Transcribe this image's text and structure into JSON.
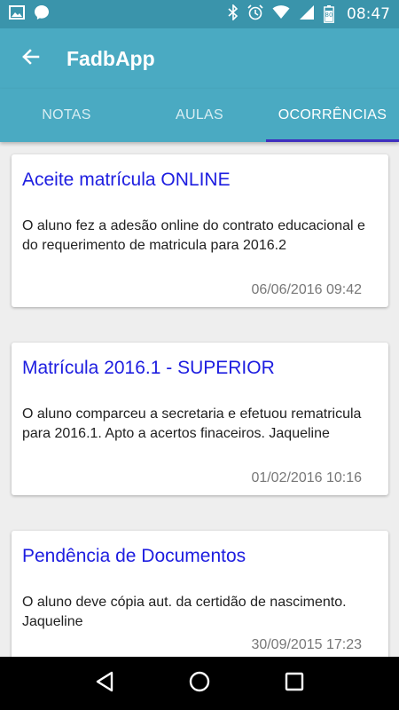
{
  "status_bar": {
    "time": "08:47",
    "battery_level": "80",
    "icons": [
      "image-icon",
      "messenger-icon",
      "bluetooth-icon",
      "alarm-icon",
      "wifi-icon",
      "signal-icon",
      "battery-icon"
    ]
  },
  "app_bar": {
    "title": "FadbApp",
    "back_icon": "arrow-back-icon"
  },
  "tabs": [
    {
      "label": "NOTAS",
      "active": false
    },
    {
      "label": "AULAS",
      "active": false
    },
    {
      "label": "OCORRÊNCIAS",
      "active": true
    }
  ],
  "cards": [
    {
      "title": "Aceite matrícula ONLINE",
      "body": "O aluno fez a adesão online do contrato educacional e do requerimento de matricula para 2016.2",
      "date": "06/06/2016 09:42"
    },
    {
      "title": "Matrícula 2016.1 - SUPERIOR",
      "body": "O aluno comparceu a secretaria e efetuou rematricula para 2016.1. Apto a acertos finaceiros. Jaqueline",
      "date": "01/02/2016 10:16"
    },
    {
      "title": "Pendência de Documentos",
      "body": "O aluno deve cópia aut. da certidão de nascimento. Jaqueline",
      "date": "30/09/2015 17:23"
    }
  ],
  "colors": {
    "status_bar": "#3a94ab",
    "app_bar": "#4aaac2",
    "tab_indicator": "#3f2fbe",
    "card_title": "#1d1de0"
  }
}
